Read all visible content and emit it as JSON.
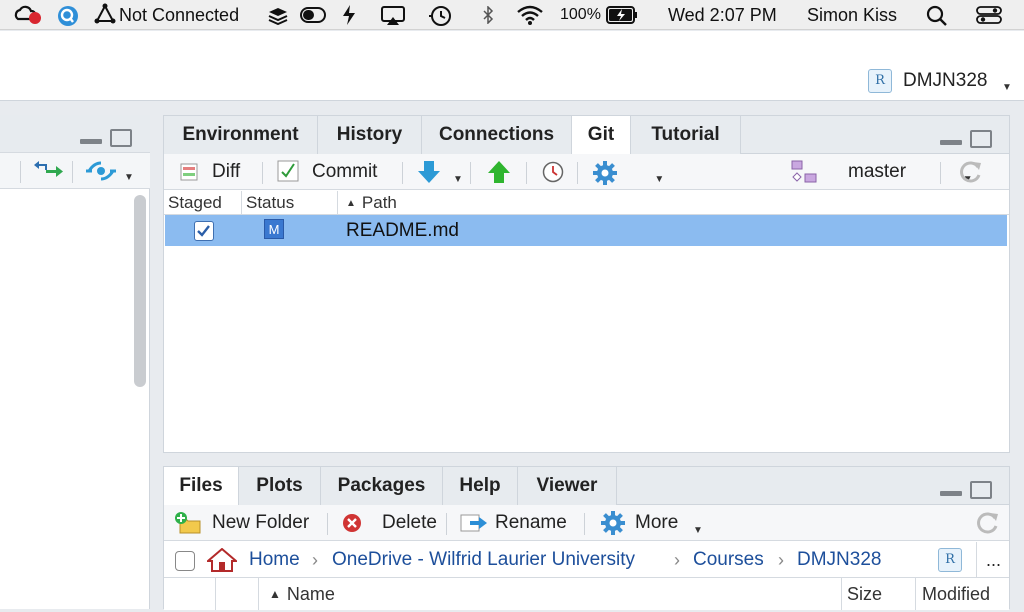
{
  "menubar": {
    "network_status": "Not Connected",
    "battery": "100%",
    "clock": "Wed 2:07 PM",
    "user": "Simon Kiss"
  },
  "project": {
    "name": "DMJN328"
  },
  "git_pane": {
    "tabs": [
      "Environment",
      "History",
      "Connections",
      "Git",
      "Tutorial"
    ],
    "active_tab": "Git",
    "toolbar": {
      "diff": "Diff",
      "commit": "Commit",
      "branch": "master"
    },
    "columns": {
      "staged": "Staged",
      "status": "Status",
      "path": "Path"
    },
    "rows": [
      {
        "staged": true,
        "status": "M",
        "path": "README.md"
      }
    ]
  },
  "files_pane": {
    "tabs": [
      "Files",
      "Plots",
      "Packages",
      "Help",
      "Viewer"
    ],
    "active_tab": "Files",
    "toolbar": {
      "new_folder": "New Folder",
      "delete": "Delete",
      "rename": "Rename",
      "more": "More"
    },
    "breadcrumb": [
      "Home",
      "OneDrive - Wilfrid Laurier University",
      "Courses",
      "DMJN328"
    ],
    "more_ellipsis": "...",
    "columns": {
      "name": "Name",
      "size": "Size",
      "modified": "Modified"
    }
  },
  "colors": {
    "selected_row": "#8bbbf0",
    "link": "#1d4f9b",
    "push_green": "#2fb52f",
    "pull_blue": "#2c9ad6"
  }
}
